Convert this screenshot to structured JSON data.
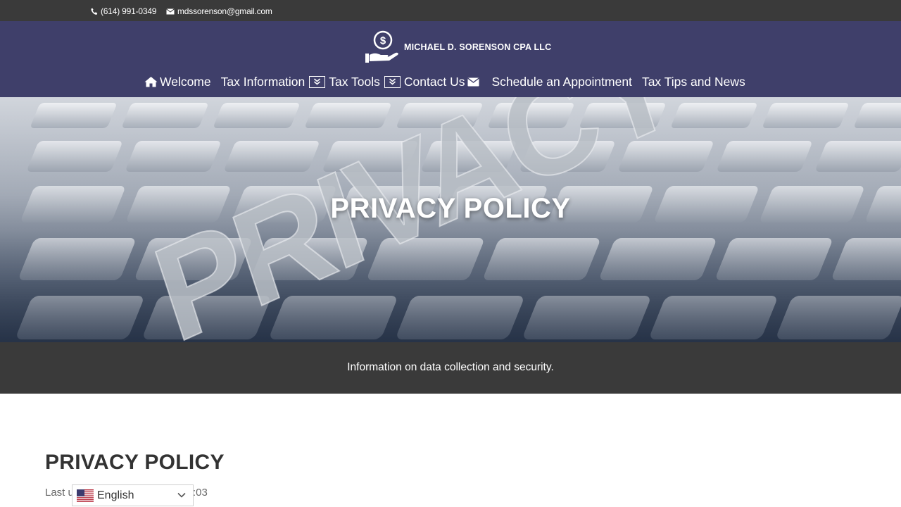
{
  "topbar": {
    "phone": "(614) 991-0349",
    "email": "mdssorenson@gmail.com",
    "phone_icon": "phone-icon",
    "email_icon": "envelope-icon"
  },
  "header": {
    "logo_text": "MICHAEL D. SORENSON CPA LLC",
    "logo_icon": "hand-dollar-coin-icon"
  },
  "nav": {
    "welcome": "Welcome",
    "tax_information": "Tax Information",
    "tax_tools": "Tax Tools",
    "contact_us": "Contact Us",
    "schedule": "Schedule an Appointment",
    "tips": "Tax Tips and News",
    "icons": [
      "home-icon",
      "chevron-double-down-icon",
      "envelope-icon"
    ]
  },
  "hero": {
    "title": "PRIVACY POLICY",
    "background": "keyboard-photo-with-privacy-lettering"
  },
  "subband": {
    "text": "Information on data collection and security."
  },
  "content": {
    "title": "PRIVACY POLICY",
    "last_updated_start": "Last u",
    "last_updated_end": ":03"
  },
  "language": {
    "selected": "English",
    "flag_icon": "us-flag-icon",
    "caret_icon": "chevron-down-icon"
  },
  "colors": {
    "topbar_bg": "#3a3a3a",
    "header_bg": "#3f3f6a",
    "subband_bg": "#3a3a3a",
    "text_dark": "#333333"
  }
}
